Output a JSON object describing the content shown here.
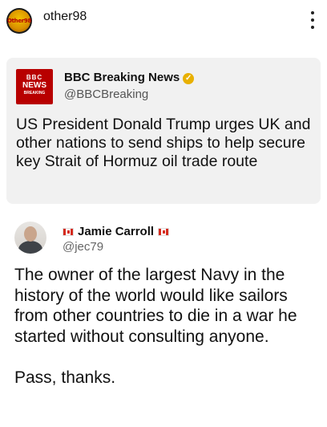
{
  "header": {
    "account_name": "other98",
    "avatar_logo_text": "Other98",
    "more_icon": "more-vertical-icon"
  },
  "quoted_post": {
    "logo": {
      "line1": "BBC",
      "line2": "NEWS",
      "line3": "BREAKING"
    },
    "display_name": "BBC Breaking News",
    "verified_icon": "verified-badge-icon",
    "verified_glyph": "✓",
    "handle": "@BBCBreaking",
    "text": "US President Donald Trump urges UK and other nations to send ships to help secure key Strait of Hormuz oil trade route",
    "colors": {
      "logo_red": "#b80000",
      "card_background": "#f1f1f1",
      "badge_gold": "#e8b000"
    }
  },
  "tweet": {
    "display_name": "Jamie Carroll",
    "flag_icon": "canada-flag-icon",
    "handle": "@jec79",
    "text": "The owner of the largest Navy in the history of the world would like sailors from other countries to die in a war he started without consulting anyone.\n\nPass, thanks."
  }
}
